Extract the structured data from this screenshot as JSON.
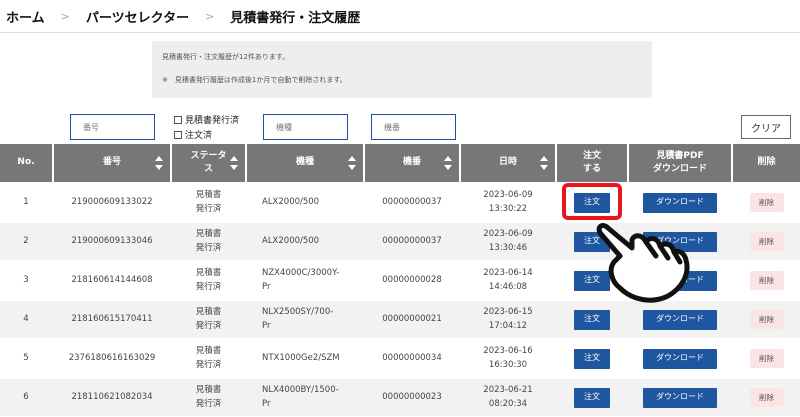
{
  "breadcrumb": {
    "home": "ホーム",
    "parts_selector": "パーツセレクター",
    "current": "見積書発行・注文履歴",
    "separator": ">"
  },
  "info": {
    "line1": "見積書発行・注文履歴が12件あります。",
    "line2": "※　見積書発行履歴は作成後1か月で自動で削除されます。"
  },
  "filters": {
    "number_placeholder": "番号",
    "model_placeholder": "機種",
    "machine_placeholder": "機番",
    "checkbox_quote": "見積書発行済",
    "checkbox_order": "注文済",
    "clear_label": "クリア"
  },
  "table": {
    "headers": {
      "no": "No.",
      "number": "番号",
      "status_line1": "ステータ",
      "status_line2": "ス",
      "model": "機種",
      "machine": "機番",
      "datetime": "日時",
      "order_line1": "注文",
      "order_line2": "する",
      "pdf_line1": "見積書PDF",
      "pdf_line2": "ダウンロード",
      "delete": "削除"
    },
    "order_label": "注文",
    "download_label": "ダウンロード",
    "delete_label": "削除",
    "rows": [
      {
        "no": "1",
        "number": "219000609133022",
        "status1": "見積書",
        "status2": "発行済",
        "model1": "ALX2000/500",
        "model2": "",
        "machine": "00000000037",
        "date": "2023-06-09",
        "time": "13:30:22"
      },
      {
        "no": "2",
        "number": "219000609133046",
        "status1": "見積書",
        "status2": "発行済",
        "model1": "ALX2000/500",
        "model2": "",
        "machine": "00000000037",
        "date": "2023-06-09",
        "time": "13:30:46"
      },
      {
        "no": "3",
        "number": "218160614144608",
        "status1": "見積書",
        "status2": "発行済",
        "model1": "NZX4000C/3000Y-",
        "model2": "Pr",
        "machine": "00000000028",
        "date": "2023-06-14",
        "time": "14:46:08"
      },
      {
        "no": "4",
        "number": "218160615170411",
        "status1": "見積書",
        "status2": "発行済",
        "model1": "NLX2500SY/700-",
        "model2": "Pr",
        "machine": "00000000021",
        "date": "2023-06-15",
        "time": "17:04:12"
      },
      {
        "no": "5",
        "number": "2376180616163029",
        "status1": "見積書",
        "status2": "発行済",
        "model1": "NTX1000Ge2/SZM",
        "model2": "",
        "machine": "00000000034",
        "date": "2023-06-16",
        "time": "16:30:30"
      },
      {
        "no": "6",
        "number": "218110621082034",
        "status1": "見積書",
        "status2": "発行済",
        "model1": "NLX4000BY/1500-",
        "model2": "Pr",
        "machine": "00000000023",
        "date": "2023-06-21",
        "time": "08:20:34"
      }
    ]
  },
  "colors": {
    "header_bg": "#777777",
    "button_blue": "#1e56a0",
    "delete_bg": "#fbe4e6",
    "highlight_red": "#e8161b",
    "filter_border": "#1f4fa3"
  },
  "icons": {
    "pointer": "pointing-hand-icon",
    "sort": "sort-icon"
  }
}
